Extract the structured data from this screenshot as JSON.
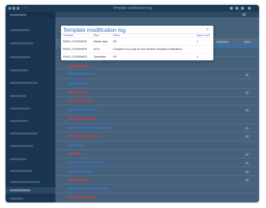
{
  "window": {
    "title": "Template modification log",
    "nav_back": "‹"
  },
  "modal": {
    "title": "Template modification log",
    "close_label": "×",
    "columns": [
      "Template",
      "Style",
      "Status",
      "Apply count"
    ],
    "rows": [
      {
        "template": "PAGE_CONTAINER",
        "style": "Master style",
        "status": "OK",
        "apply_count": "1"
      },
      {
        "template": "PAGE_CONTAINER",
        "style": "ACUI",
        "status": "Compiler error (may be from another template modification)",
        "apply_count": "-"
      },
      {
        "template": "PAGE_CONTAINER",
        "style": "Tylerdustin",
        "status": "OK",
        "apply_count": "1"
      }
    ]
  },
  "colors": {
    "accent": "#1e73be",
    "sidebar": "#1a3550",
    "overlay": "#46617b",
    "error_bar": "#c24a4a",
    "link_bar": "#2f6bb5"
  }
}
